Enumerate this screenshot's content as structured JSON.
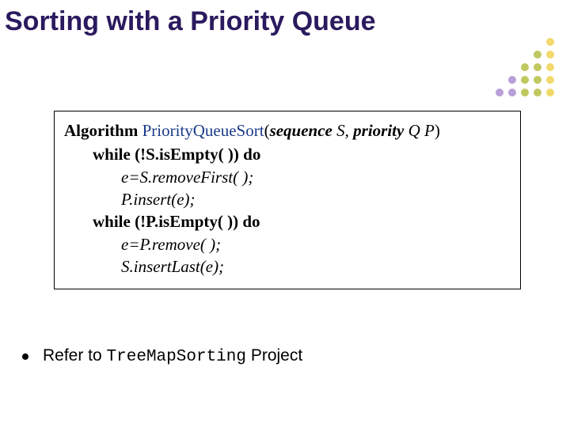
{
  "title": "Sorting with a Priority Queue",
  "algorithm": {
    "label": "Algorithm",
    "name": "PriorityQueueSort",
    "params_open": "(",
    "params_type1": "sequence",
    "params_arg1": " S",
    "params_comma": ", ",
    "params_type2": "priority",
    "params_arg2": " Q P",
    "params_close": ")",
    "lines": [
      {
        "level": 1,
        "bold": true,
        "italic": false,
        "text": "while (!S.isEmpty( )) do"
      },
      {
        "level": 2,
        "bold": false,
        "italic": true,
        "text": "e=S.removeFirst( );"
      },
      {
        "level": 2,
        "bold": false,
        "italic": true,
        "text": "P.insert(e);"
      },
      {
        "level": 1,
        "bold": true,
        "italic": false,
        "text": "while (!P.isEmpty( )) do"
      },
      {
        "level": 2,
        "bold": false,
        "italic": true,
        "text": "e=P.remove( );"
      },
      {
        "level": 2,
        "bold": false,
        "italic": true,
        "text": "S.insertLast(e);"
      }
    ]
  },
  "bullet": {
    "prefix": "Refer to ",
    "code": "TreeMapSorting",
    "suffix": " Project"
  },
  "colors": {
    "title": "#2a1a5e",
    "alg_name": "#1a3a8a"
  }
}
